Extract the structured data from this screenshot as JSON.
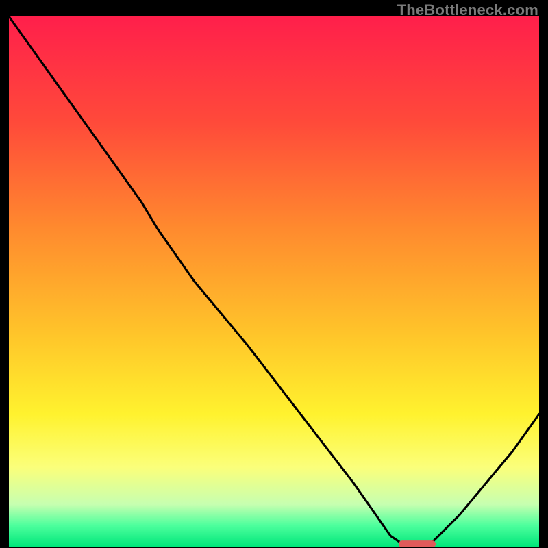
{
  "watermark": "TheBottleneck.com",
  "chart_data": {
    "type": "line",
    "title": "",
    "xlabel": "",
    "ylabel": "",
    "xlim": [
      0,
      100
    ],
    "ylim": [
      0,
      100
    ],
    "grid": false,
    "series": [
      {
        "name": "bottleneck-curve",
        "x": [
          0,
          5,
          10,
          15,
          20,
          25,
          28,
          35,
          45,
          55,
          65,
          72,
          75,
          78,
          80,
          85,
          90,
          95,
          100
        ],
        "y": [
          100,
          93,
          86,
          79,
          72,
          65,
          60,
          50,
          38,
          25,
          12,
          2,
          0,
          0,
          1,
          6,
          12,
          18,
          25
        ]
      }
    ],
    "marker": {
      "name": "optimal-marker",
      "x": 77,
      "y": 0.5,
      "width": 7,
      "height": 1.3,
      "color": "#e05a5a"
    },
    "background_gradient": {
      "stops": [
        {
          "offset": 0.0,
          "color": "#ff1f4b"
        },
        {
          "offset": 0.2,
          "color": "#ff4a3a"
        },
        {
          "offset": 0.4,
          "color": "#ff8a2e"
        },
        {
          "offset": 0.6,
          "color": "#ffc52a"
        },
        {
          "offset": 0.75,
          "color": "#fff22e"
        },
        {
          "offset": 0.85,
          "color": "#fbff7a"
        },
        {
          "offset": 0.92,
          "color": "#c7ffb0"
        },
        {
          "offset": 0.96,
          "color": "#4dff9d"
        },
        {
          "offset": 1.0,
          "color": "#00e67a"
        }
      ]
    }
  }
}
